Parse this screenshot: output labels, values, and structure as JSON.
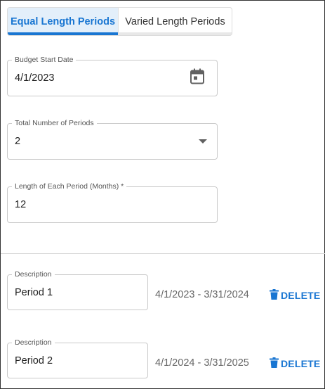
{
  "tabs": {
    "equal": "Equal Length Periods",
    "varied": "Varied Length Periods"
  },
  "budget_start": {
    "label": "Budget Start Date",
    "value": "4/1/2023",
    "icon": "calendar-icon"
  },
  "total_periods": {
    "label": "Total Number of Periods",
    "value": "2",
    "icon": "dropdown-arrow-icon"
  },
  "period_length": {
    "label": "Length of Each Period (Months) *",
    "value": "12"
  },
  "periods": [
    {
      "desc_label": "Description",
      "name": "Period 1",
      "range": "4/1/2023 - 3/31/2024",
      "delete": "DELETE"
    },
    {
      "desc_label": "Description",
      "name": "Period 2",
      "range": "4/1/2024 - 3/31/2025",
      "delete": "DELETE"
    }
  ],
  "colors": {
    "accent": "#1976d2",
    "active_tab_bg": "#e3effa"
  }
}
